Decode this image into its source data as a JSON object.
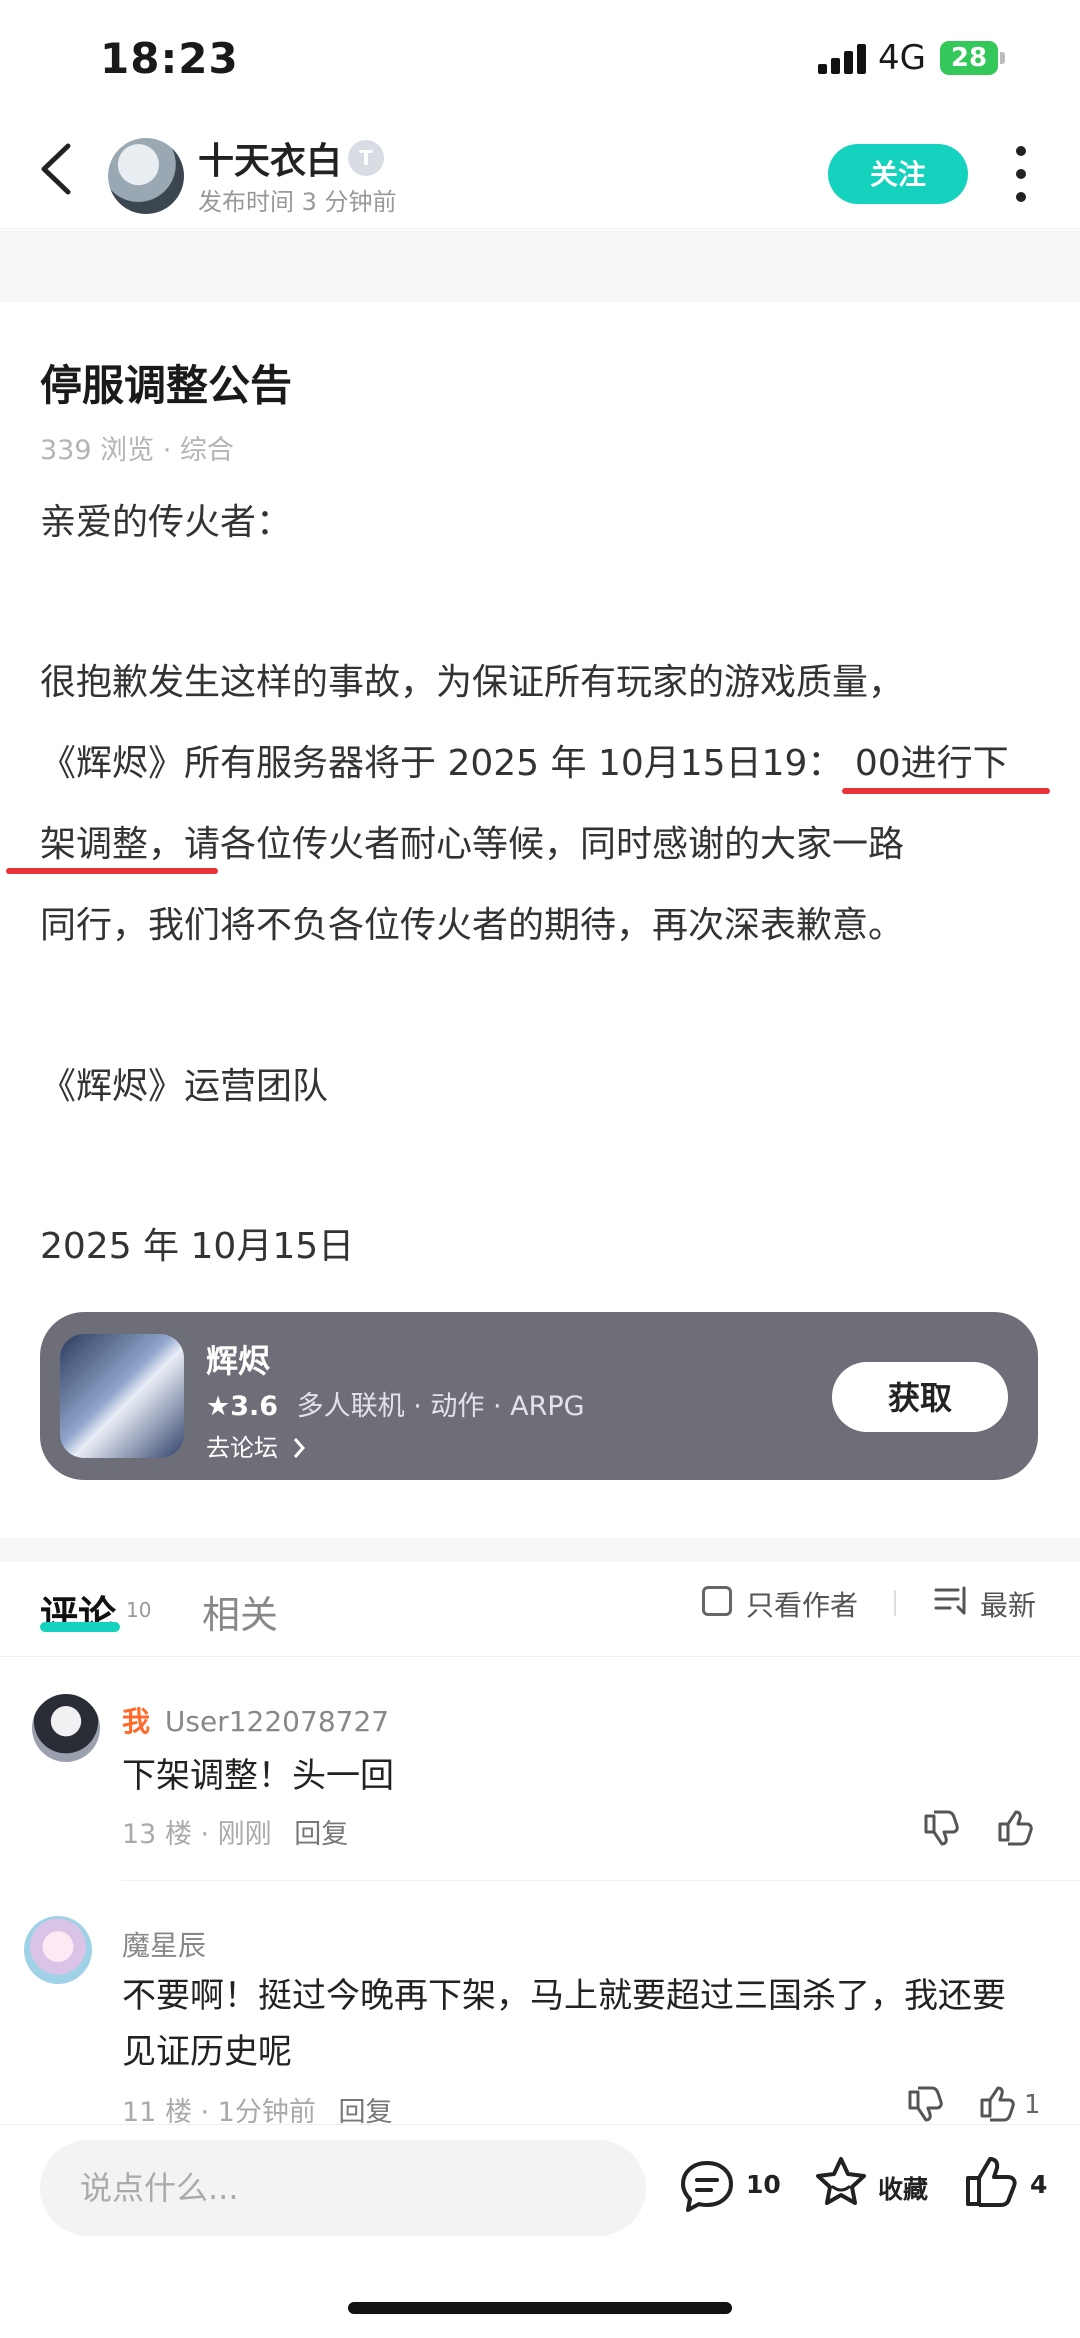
{
  "status_bar": {
    "time": "18:23",
    "network": "4G",
    "battery": "28"
  },
  "header": {
    "author": "十天衣白",
    "level_badge": "T",
    "post_time": "发布时间 3 分钟前",
    "follow_label": "关注"
  },
  "article": {
    "title": "停服调整公告",
    "meta": "339 浏览 · 综合",
    "greeting": "亲爱的传火者：",
    "body_lines": [
      "很抱歉发生这样的事故，为保证所有玩家的游戏质量，",
      "《辉烬》所有服务器将于 2025 年 10月15日19： 00进行下",
      "架调整，请各位传火者耐心等候，同时感谢的大家一路",
      "同行，我们将不负各位传火者的期待，再次深表歉意。"
    ],
    "signature": "《辉烬》运营团队",
    "date": "2025 年 10月15日"
  },
  "game_card": {
    "name": "辉烬",
    "rating": "★3.6",
    "tags": "多人联机 · 动作 · ARPG",
    "forum_link": "去论坛",
    "get_label": "获取"
  },
  "comments_section": {
    "tab_comments": "评论",
    "tab_comments_count": "10",
    "tab_related": "相关",
    "author_only_label": "只看作者",
    "sort_label": "最新",
    "comments": [
      {
        "me_tag": "我",
        "user": "User122078727",
        "text_lines": [
          "下架调整！头一回"
        ],
        "meta": "13 楼 · 刚刚",
        "reply_label": "回复",
        "likes": ""
      },
      {
        "me_tag": "",
        "user": "魔星辰",
        "text_lines": [
          "不要啊！挺过今晚再下架，马上就要超过三国杀了，我还要",
          "见证历史呢"
        ],
        "meta": "11 楼 · 1分钟前",
        "reply_label": "回复",
        "likes": "1"
      }
    ]
  },
  "bottom_bar": {
    "input_placeholder": "说点什么...",
    "comment_count": "10",
    "favorite_label": "收藏",
    "like_count": "4"
  },
  "colors": {
    "accent": "#15d2be",
    "highlight_underline": "#e8333a",
    "me_tag": "#ff6a2b",
    "card_bg": "#6e6e78"
  }
}
